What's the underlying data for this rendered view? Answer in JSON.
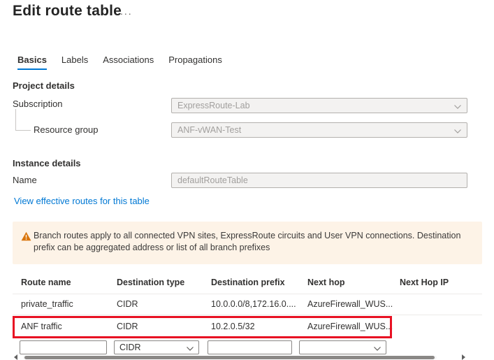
{
  "header": {
    "title": "Edit route table",
    "more": "..."
  },
  "tabs": {
    "active": "Basics",
    "items": [
      {
        "label": "Basics"
      },
      {
        "label": "Labels"
      },
      {
        "label": "Associations"
      },
      {
        "label": "Propagations"
      }
    ]
  },
  "project": {
    "heading": "Project details",
    "subscription_label": "Subscription",
    "subscription_value": "ExpressRoute-Lab",
    "resource_group_label": "Resource group",
    "resource_group_value": "ANF-vWAN-Test"
  },
  "instance": {
    "heading": "Instance details",
    "name_label": "Name",
    "name_value": "defaultRouteTable"
  },
  "link": {
    "text": "View effective routes for this table"
  },
  "warning": {
    "text": "Branch routes apply to all connected VPN sites, ExpressRoute circuits and User VPN connections. Destination prefix can be aggregated address or list of all branch prefixes"
  },
  "routes": {
    "columns": [
      "Route name",
      "Destination type",
      "Destination prefix",
      "Next hop",
      "Next Hop IP"
    ],
    "rows": [
      {
        "name": "private_traffic",
        "type": "CIDR",
        "prefix": "10.0.0.0/8,172.16.0....",
        "next_hop": "AzureFirewall_WUS...",
        "next_hop_ip": ""
      },
      {
        "name": "ANF traffic",
        "type": "CIDR",
        "prefix": "10.2.0.5/32",
        "next_hop": "AzureFirewall_WUS...",
        "next_hop_ip": "",
        "highlighted": "true"
      }
    ],
    "new_row": {
      "name_value": "",
      "type_value": "CIDR",
      "prefix_value": "",
      "next_hop_value": ""
    }
  },
  "colors": {
    "accent": "#0078d4",
    "link": "#0078d4",
    "text": "#323130",
    "text-secondary": "#605e5c",
    "disabled-bg": "#f3f2f1",
    "disabled-text": "#a19f9d",
    "disabled-border": "#b3b0ad",
    "input-border": "#8a8886",
    "divider": "#edebe9",
    "warning-bg": "#fdf3e7",
    "warning-icon": "#d9750b",
    "highlight-red": "#e81123",
    "scrollbar-thumb": "#8a8886"
  }
}
